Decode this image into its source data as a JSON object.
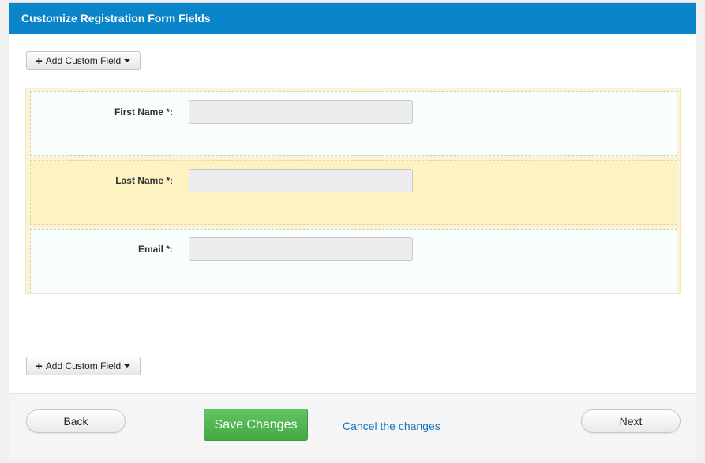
{
  "header": {
    "title": "Customize Registration Form Fields"
  },
  "add_field_button": {
    "label": "Add Custom Field"
  },
  "fields": [
    {
      "label": "First Name *:",
      "value": ""
    },
    {
      "label": "Last Name *:",
      "value": ""
    },
    {
      "label": "Email *:",
      "value": ""
    }
  ],
  "footer": {
    "back_label": "Back",
    "save_label": "Save Changes",
    "cancel_label": "Cancel the changes",
    "next_label": "Next"
  },
  "colors": {
    "header_bg": "#0a85c9",
    "save_bg": "#51b351",
    "link": "#1a73b8",
    "highlight_row": "#fdf2c2"
  }
}
